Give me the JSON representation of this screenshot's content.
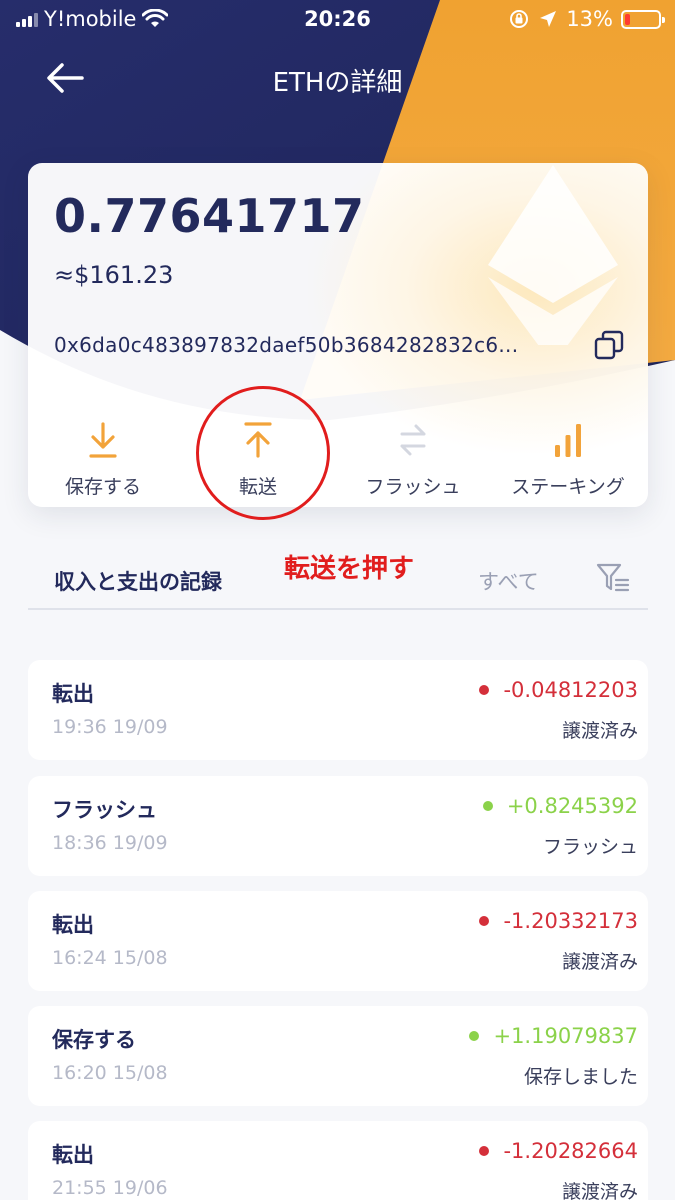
{
  "status_bar": {
    "carrier": "Y!mobile",
    "time": "20:26",
    "battery": "13%"
  },
  "header": {
    "title": "ETHの詳細"
  },
  "wallet": {
    "balance": "0.77641717",
    "fiat_value": "≈$161.23",
    "address": "0x6da0c483897832daef50b3684282832c6..."
  },
  "actions": [
    {
      "label": "保存する",
      "icon": "download-icon",
      "enabled": true
    },
    {
      "label": "転送",
      "icon": "upload-icon",
      "enabled": true
    },
    {
      "label": "フラッシュ",
      "icon": "swap-icon",
      "enabled": false
    },
    {
      "label": "ステーキング",
      "icon": "bar-chart-icon",
      "enabled": true
    }
  ],
  "annotation": {
    "text": "転送を押す"
  },
  "records_header": {
    "title": "収入と支出の記録",
    "filter_label": "すべて"
  },
  "records": [
    {
      "type": "転出",
      "time": "19:36 19/09",
      "amount": "-0.04812203",
      "status": "譲渡済み",
      "direction": "out"
    },
    {
      "type": "フラッシュ",
      "time": "18:36 19/09",
      "amount": "+0.8245392",
      "status": "フラッシュ",
      "direction": "in"
    },
    {
      "type": "転出",
      "time": "16:24 15/08",
      "amount": "-1.20332173",
      "status": "譲渡済み",
      "direction": "out"
    },
    {
      "type": "保存する",
      "time": "16:20 15/08",
      "amount": "+1.19079837",
      "status": "保存しました",
      "direction": "in"
    },
    {
      "type": "転出",
      "time": "21:55 19/06",
      "amount": "-1.20282664",
      "status": "譲渡済み",
      "direction": "out"
    }
  ],
  "colors": {
    "navy": "#232a5c",
    "orange": "#f2a33a",
    "negative": "#d42f3a",
    "positive": "#8bd24a",
    "annotation": "#e11d1d"
  }
}
